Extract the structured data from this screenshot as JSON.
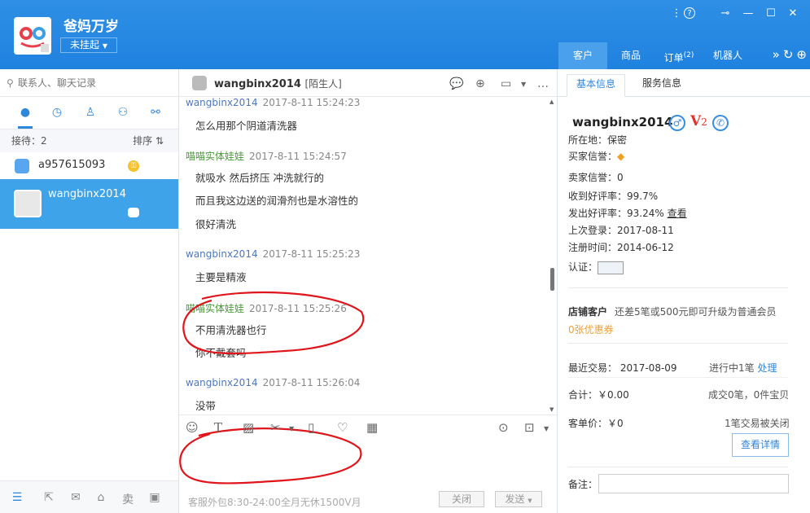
{
  "header": {
    "shop_name": "爸妈万岁",
    "status": "未挂起",
    "nav": [
      {
        "label": "客户"
      },
      {
        "label": "商品"
      },
      {
        "label": "订单",
        "badge": "(2)"
      },
      {
        "label": "机器人"
      }
    ]
  },
  "left": {
    "search_placeholder": "联系人、聊天记录",
    "reception": "接待：2",
    "sort": "排序",
    "contacts": [
      {
        "name": "a957615093"
      },
      {
        "name": "wangbinx2014"
      }
    ]
  },
  "chat": {
    "contact": "wangbinx2014",
    "tag": "[陌生人]",
    "messages": [
      {
        "sender": "wangbinx2014",
        "time": "2017-8-11 15:24:23",
        "lines": [
          "怎么用那个阴道清洗器"
        ]
      },
      {
        "sender": "喵喵实体娃娃",
        "time": "2017-8-11 15:24:57",
        "lines": [
          "就吸水  然后挤压  冲洗就行的",
          "而且我这边送的润滑剂也是水溶性的",
          "很好清洗"
        ]
      },
      {
        "sender": "wangbinx2014",
        "time": "2017-8-11 15:25:23",
        "lines": [
          "主要是精液"
        ]
      },
      {
        "sender": "喵喵实体娃娃",
        "time": "2017-8-11 15:25:26",
        "lines": [
          "不用清洗器也行",
          "你不戴套吗"
        ]
      },
      {
        "sender": "wangbinx2014",
        "time": "2017-8-11 15:26:04",
        "lines": [
          "没带"
        ]
      }
    ],
    "footer_hours": "客服外包8:30-24:00全月无休1500V月",
    "close_label": "关闭",
    "send_label": "发送"
  },
  "right": {
    "tabs": [
      "基本信息",
      "服务信息"
    ],
    "name": "wangbinx2014",
    "level": "V",
    "level_num": "2",
    "location": "所在地：保密",
    "buyer_credit": "买家信誉：",
    "seller_credit": "卖家信誉：0",
    "received_rate": "收到好评率：99.7%",
    "given_rate": "发出好评率：93.24%",
    "view_link": "查看",
    "last_login": "上次登录：2017-08-11",
    "register": "注册时间：2014-06-12",
    "auth": "认证：",
    "store_customer": "店铺客户",
    "upgrade_hint": "还差5笔或500元即可升级为普通会员",
    "coupons": "0张优惠券",
    "last_trade": "最近交易：  2017-08-09",
    "in_progress": "进行中1笔",
    "handle": "处理",
    "total": "合计：￥0.00",
    "deals": "成交0笔，0件宝贝",
    "unit_price": "客单价：￥0",
    "closed": "1笔交易被关闭",
    "detail_btn": "查看详情",
    "memo_label": "备注："
  },
  "colors": {
    "header": "#2285e0",
    "active_contact": "#3fa3ea",
    "customer_name": "#4a78c2",
    "seller_name": "#4a9a3a",
    "annotation": "#e0151b"
  }
}
